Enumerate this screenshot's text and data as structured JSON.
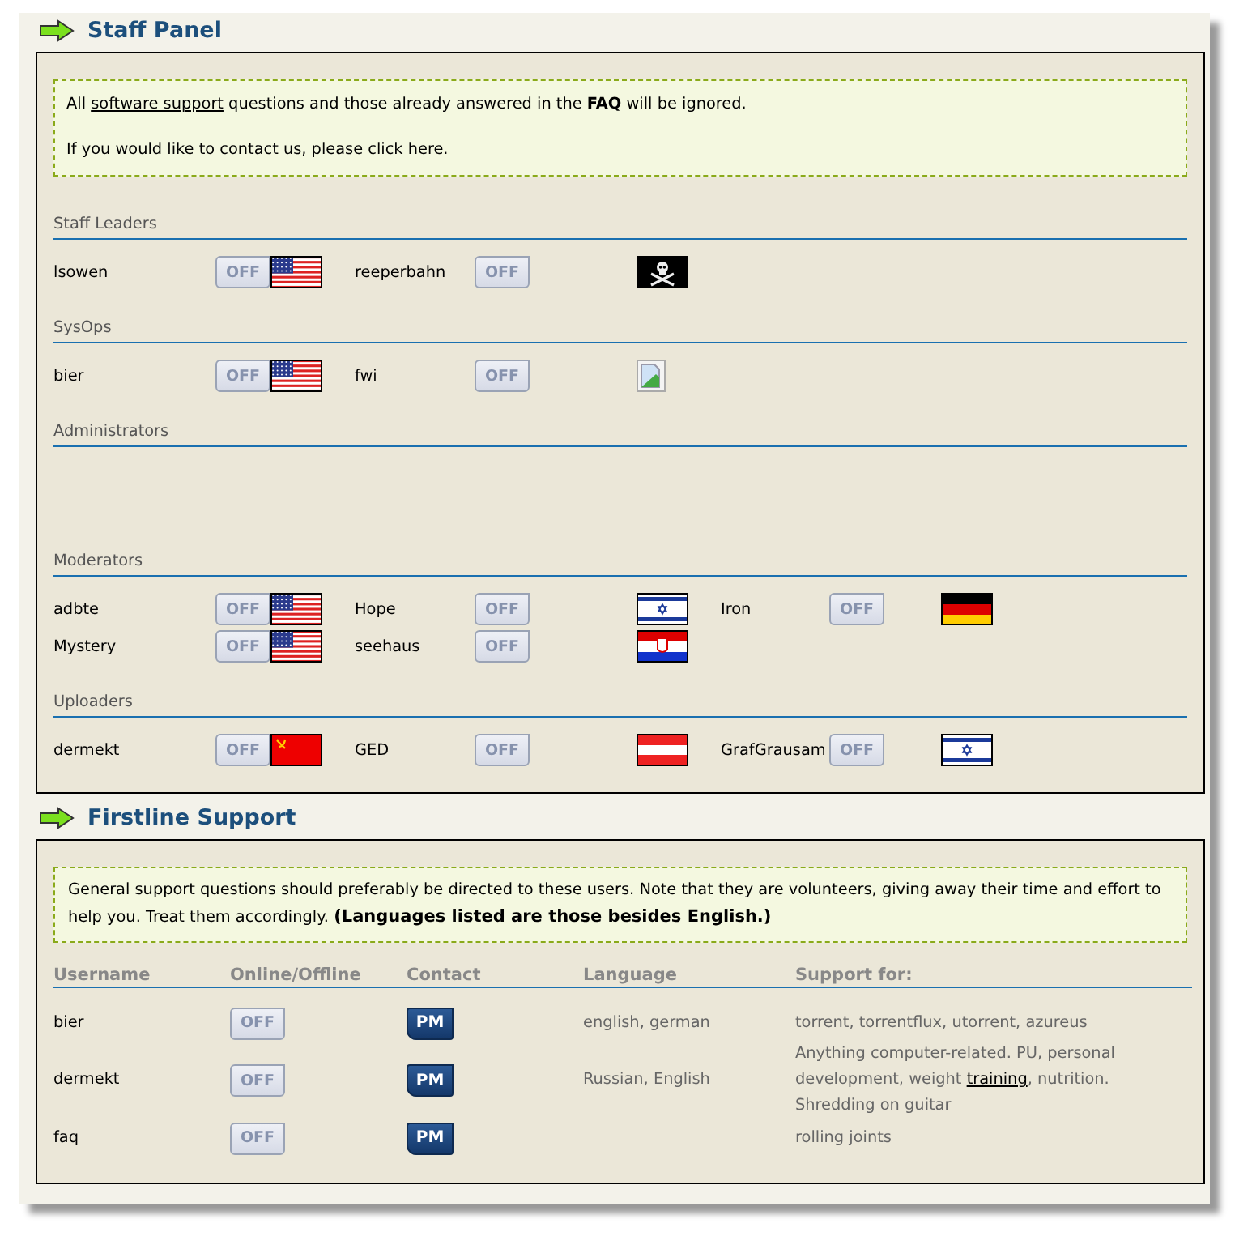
{
  "panels": [
    {
      "title": "Staff Panel",
      "kind": "staff",
      "notice": [
        [
          {
            "text": "All "
          },
          {
            "text": "software support",
            "kind": "link"
          },
          {
            "text": " questions and those already answered in the "
          },
          {
            "text": "FAQ",
            "kind": "bold"
          },
          {
            "text": " will be ignored."
          }
        ],
        [
          {
            "text": "If you would like to contact us, please click here."
          }
        ]
      ],
      "sections": [
        {
          "title": "Staff Leaders",
          "members": [
            {
              "name": "lsowen",
              "status": "OFF",
              "online": false,
              "flag": {
                "kind": "us"
              }
            },
            {
              "name": "reeperbahn",
              "status": "OFF",
              "online": false,
              "flag": {
                "kind": "pirate"
              }
            }
          ]
        },
        {
          "title": "SysOps",
          "members": [
            {
              "name": "bier",
              "status": "OFF",
              "online": false,
              "flag": {
                "kind": "us"
              }
            },
            {
              "name": "fwi",
              "status": "OFF",
              "online": false,
              "flag": {
                "kind": "broken"
              }
            }
          ]
        },
        {
          "title": "Administrators"
        },
        {
          "title": "Moderators",
          "members": [
            {
              "name": "adbte",
              "status": "OFF",
              "online": false,
              "flag": {
                "kind": "us"
              }
            },
            {
              "name": "Hope",
              "status": "OFF",
              "online": false,
              "flag": {
                "kind": "israel"
              }
            },
            {
              "name": "Iron",
              "status": "OFF",
              "online": false,
              "flag": {
                "kind": "germany"
              }
            },
            {
              "name": "Mystery",
              "status": "OFF",
              "online": false,
              "flag": {
                "kind": "us"
              }
            },
            {
              "name": "seehaus",
              "status": "OFF",
              "online": false,
              "flag": {
                "kind": "croatia"
              }
            }
          ]
        },
        {
          "title": "Uploaders",
          "members": [
            {
              "name": "dermekt",
              "status": "OFF",
              "online": false,
              "flag": {
                "kind": "ussr"
              }
            },
            {
              "name": "GED",
              "status": "OFF",
              "online": false,
              "flag": {
                "kind": "austria"
              }
            },
            {
              "name": "GrafGrausam",
              "status": "OFF",
              "online": false,
              "flag": {
                "kind": "israel"
              }
            }
          ]
        }
      ]
    },
    {
      "title": "Firstline Support",
      "kind": "support",
      "notice": [
        [
          {
            "text": "General support questions should preferably be directed to these users. Note that they are volunteers, giving away their time and effort to help you. Treat them accordingly. "
          },
          {
            "text": "(Languages listed are those besides English.)",
            "kind": "bold"
          }
        ]
      ],
      "table": {
        "columns": [
          "Username",
          "Online/Offline",
          "Contact",
          "Language",
          "Support for:"
        ],
        "rows": [
          {
            "username": "bier",
            "status": "OFF",
            "online": false,
            "contact": "PM",
            "language": "english, german",
            "support": [
              {
                "text": "torrent, torrentflux, utorrent, azureus"
              }
            ]
          },
          {
            "username": "dermekt",
            "status": "OFF",
            "online": false,
            "contact": "PM",
            "language": "Russian, English",
            "support": [
              {
                "text": "Anything computer-related. PU, personal development, weight "
              },
              {
                "text": "training",
                "kind": "link"
              },
              {
                "text": ", nutrition. Shredding on guitar"
              }
            ]
          },
          {
            "username": "faq",
            "status": "OFF",
            "online": false,
            "contact": "PM",
            "support": [
              {
                "text": "rolling joints"
              }
            ]
          }
        ]
      }
    }
  ]
}
